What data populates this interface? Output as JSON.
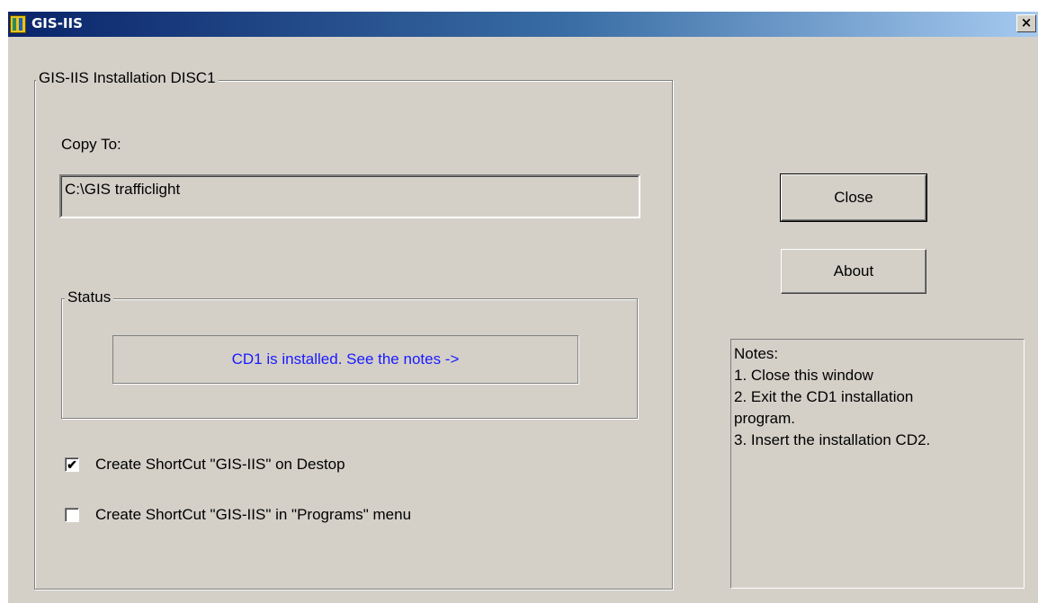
{
  "window": {
    "title": "GIS-IIS",
    "close_glyph": "×"
  },
  "install_group": {
    "legend": "GIS-IIS Installation DISC1",
    "copy_to_label": "Copy To:",
    "copy_to_value": "C:\\GIS trafficlight"
  },
  "status_group": {
    "legend": "Status",
    "message": "CD1 is installed. See the notes ->",
    "message_color": "#1a1aff"
  },
  "options": {
    "desktop_shortcut": {
      "label": "Create ShortCut \"GIS-IIS\" on Destop",
      "checked": true,
      "mark": "✔"
    },
    "programs_shortcut": {
      "label": "Create ShortCut \"GIS-IIS\" in \"Programs\" menu",
      "checked": false,
      "mark": ""
    }
  },
  "buttons": {
    "close": "Close",
    "about": "About"
  },
  "notes": {
    "lines": [
      "Notes:",
      "1. Close this window",
      "2. Exit the CD1 installation",
      "program.",
      "3. Insert the installation CD2."
    ]
  },
  "colors": {
    "titlebar_start": "#0a246a",
    "titlebar_end": "#a6caf0",
    "face": "#d4d0c8"
  }
}
